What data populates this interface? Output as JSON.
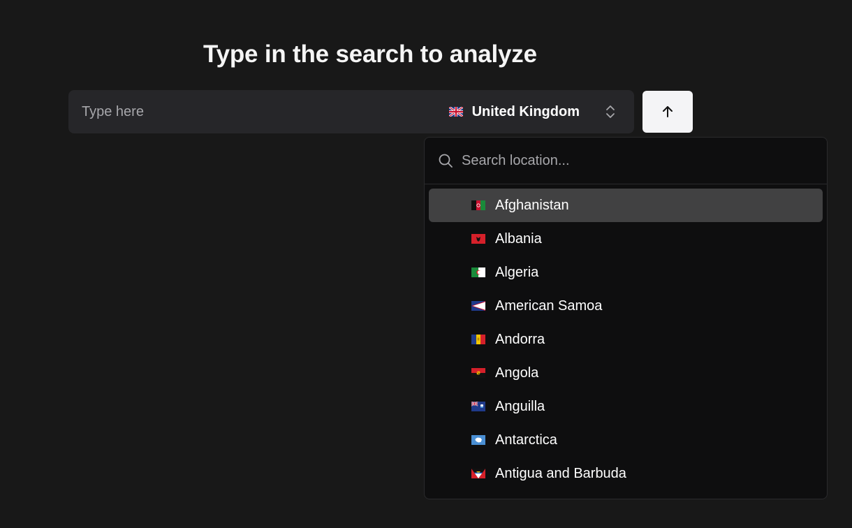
{
  "heading": "Type in the search to analyze",
  "search": {
    "placeholder": "Type here",
    "selected_country": "United Kingdom",
    "selected_country_flag": "flag-gb"
  },
  "submit": {
    "icon": "arrow-up-icon"
  },
  "location_dropdown": {
    "search_placeholder": "Search location...",
    "highlighted_index": 0,
    "options": [
      {
        "label": "Afghanistan",
        "flag": "flag-af"
      },
      {
        "label": "Albania",
        "flag": "flag-al"
      },
      {
        "label": "Algeria",
        "flag": "flag-dz"
      },
      {
        "label": "American Samoa",
        "flag": "flag-as"
      },
      {
        "label": "Andorra",
        "flag": "flag-ad"
      },
      {
        "label": "Angola",
        "flag": "flag-ao"
      },
      {
        "label": "Anguilla",
        "flag": "flag-ai"
      },
      {
        "label": "Antarctica",
        "flag": "flag-aq"
      },
      {
        "label": "Antigua and Barbuda",
        "flag": "flag-ag"
      }
    ]
  },
  "colors": {
    "background": "#181818",
    "input_bg": "#262629",
    "dropdown_bg": "#0e0e0f",
    "highlight_bg": "#414142",
    "button_bg": "#f4f4f6"
  }
}
